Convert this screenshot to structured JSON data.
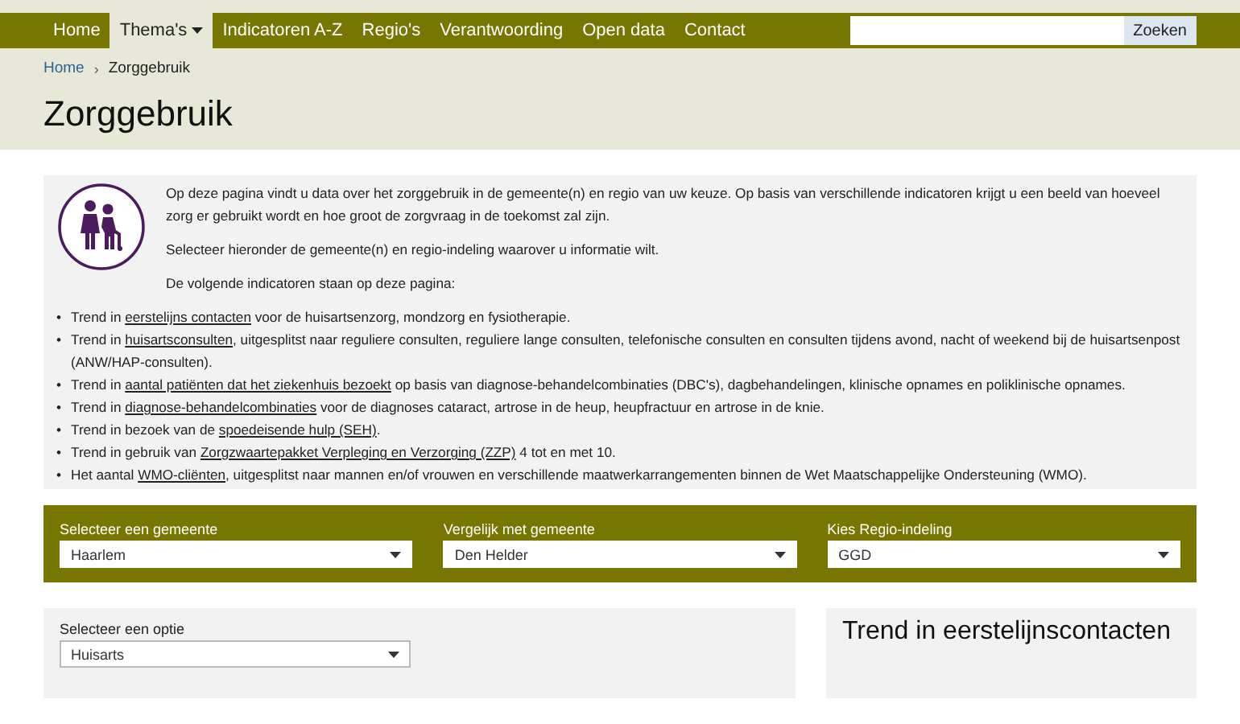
{
  "nav": {
    "items": [
      {
        "label": "Home",
        "selected": false,
        "dropdown": false
      },
      {
        "label": "Thema's",
        "selected": true,
        "dropdown": true
      },
      {
        "label": "Indicatoren A-Z",
        "selected": false,
        "dropdown": false
      },
      {
        "label": "Regio's",
        "selected": false,
        "dropdown": false
      },
      {
        "label": "Verantwoording",
        "selected": false,
        "dropdown": false
      },
      {
        "label": "Open data",
        "selected": false,
        "dropdown": false
      },
      {
        "label": "Contact",
        "selected": false,
        "dropdown": false
      }
    ],
    "search": {
      "button": "Zoeken"
    }
  },
  "breadcrumb": [
    {
      "label": "Home"
    },
    {
      "label": "Zorggebruik"
    }
  ],
  "breadcrumb_separator": "›",
  "bullet_marker": "•",
  "page_title": "Zorggebruik",
  "intro": {
    "paragraphs": [
      "Op deze pagina vindt u data over het zorggebruik in de gemeente(n) en regio van uw keuze. Op basis van verschillende indicatoren krijgt u een beeld van hoeveel zorg er gebruikt wordt en hoe groot de zorgvraag in de toekomst zal zijn.",
      "Selecteer hieronder de gemeente(n) en regio-indeling waarover u informatie wilt.",
      "De volgende indicatoren staan op deze pagina:"
    ],
    "bullets": [
      {
        "before": "Trend in ",
        "link": "eerstelijns contacten",
        "after": " voor de huisartsenzorg, mondzorg en fysiotherapie."
      },
      {
        "before": "Trend in ",
        "link": "huisartsconsulten",
        "after": ", uitgesplitst naar reguliere consulten, reguliere lange consulten, telefonische consulten en consulten tijdens avond, nacht of weekend bij de huisartsenpost (ANW/HAP-consulten)."
      },
      {
        "before": "Trend in ",
        "link": "aantal patiënten dat het ziekenhuis bezoekt",
        "after": " op basis van diagnose-behandelcombinaties (DBC's), dagbehandelingen, klinische opnames en poliklinische opnames."
      },
      {
        "before": "Trend in ",
        "link": "diagnose-behandelcombinaties",
        "after": " voor de diagnoses cataract, artrose in de heup, heupfractuur en artrose in de knie."
      },
      {
        "before": "Trend in bezoek van de ",
        "link": "spoedeisende hulp (SEH)",
        "after": "."
      },
      {
        "before": "Trend in gebruik van ",
        "link": "Zorgzwaartepakket Verpleging en Verzorging (ZZP)",
        "after": " 4 tot en met 10."
      },
      {
        "before": "Het aantal ",
        "link": "WMO-cliënten",
        "after": ", uitgesplitst naar mannen en/of vrouwen en verschillende maatwerkarrangementen binnen de Wet Maatschappelijke Ondersteuning (WMO)."
      }
    ]
  },
  "filters": [
    {
      "label": "Selecteer een gemeente",
      "value": "Haarlem"
    },
    {
      "label": "Vergelijk met gemeente",
      "value": "Den Helder"
    },
    {
      "label": "Kies Regio-indeling",
      "value": "GGD"
    }
  ],
  "option_panel": {
    "label": "Selecteer een optie",
    "value": "Huisarts"
  },
  "side_panel": {
    "title": "Trend in eerstelijnscontacten"
  }
}
